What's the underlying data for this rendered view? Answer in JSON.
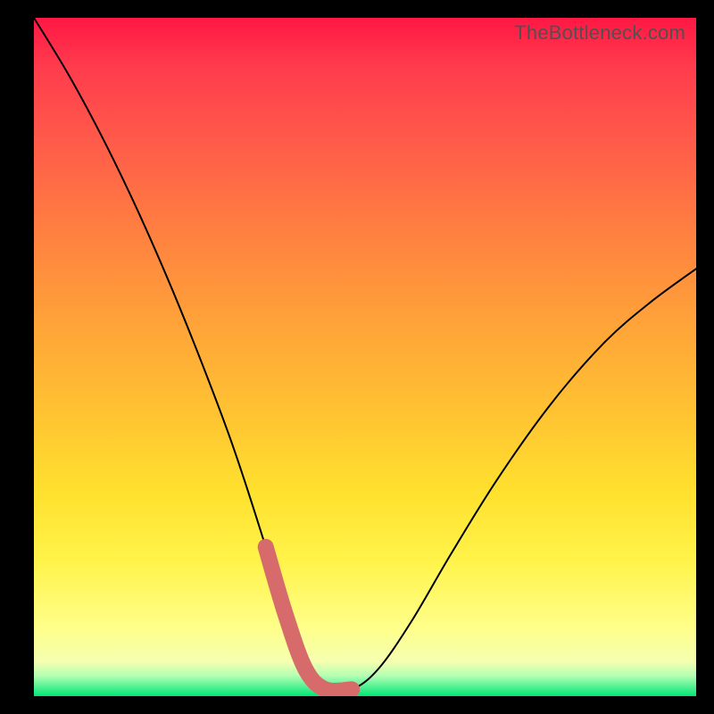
{
  "watermark": "TheBottleneck.com",
  "chart_data": {
    "type": "line",
    "title": "",
    "xlabel": "",
    "ylabel": "",
    "xlim": [
      0,
      100
    ],
    "ylim": [
      0,
      100
    ],
    "series": [
      {
        "name": "bottleneck-curve",
        "x": [
          0,
          5,
          10,
          15,
          20,
          25,
          30,
          35,
          38,
          41,
          44,
          48,
          52,
          57,
          63,
          70,
          78,
          86,
          93,
          100
        ],
        "values": [
          100,
          92,
          83,
          73,
          62,
          50,
          37,
          22,
          12,
          4,
          1,
          1,
          4,
          11,
          21,
          32,
          43,
          52,
          58,
          63
        ]
      }
    ],
    "highlight": {
      "color": "#d76b6b",
      "x_range": [
        36,
        50
      ],
      "note": "thick rounded segment at valley bottom"
    },
    "background_gradient": {
      "direction": "vertical",
      "stops": [
        {
          "pos": 0.0,
          "color": "#ff1744"
        },
        {
          "pos": 0.32,
          "color": "#ff8140"
        },
        {
          "pos": 0.7,
          "color": "#ffe12e"
        },
        {
          "pos": 0.95,
          "color": "#f4ffb0"
        },
        {
          "pos": 1.0,
          "color": "#00e676"
        }
      ]
    }
  }
}
